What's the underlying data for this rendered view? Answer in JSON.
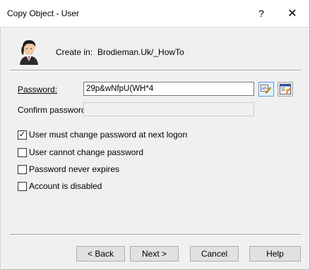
{
  "window": {
    "title": "Copy Object - User",
    "help_glyph": "?",
    "close_glyph": "✕"
  },
  "header": {
    "icon": "user-icon",
    "create_in_label": "Create in:",
    "create_in_value": "Brodieman.Uk/_HowTo"
  },
  "password": {
    "label": "Password:",
    "value": "29p&wNfpU(WH*4",
    "generate_icon": "generate-password-icon",
    "properties_icon": "password-properties-icon"
  },
  "confirm_password": {
    "label": "Confirm password:",
    "value": ""
  },
  "options": [
    {
      "label": "User must change password at next logon",
      "checked": true
    },
    {
      "label": "User cannot change password",
      "checked": false
    },
    {
      "label": "Password never expires",
      "checked": false
    },
    {
      "label": "Account is disabled",
      "checked": false
    }
  ],
  "buttons": {
    "back": "< Back",
    "next": "Next >",
    "cancel": "Cancel",
    "help": "Help"
  }
}
